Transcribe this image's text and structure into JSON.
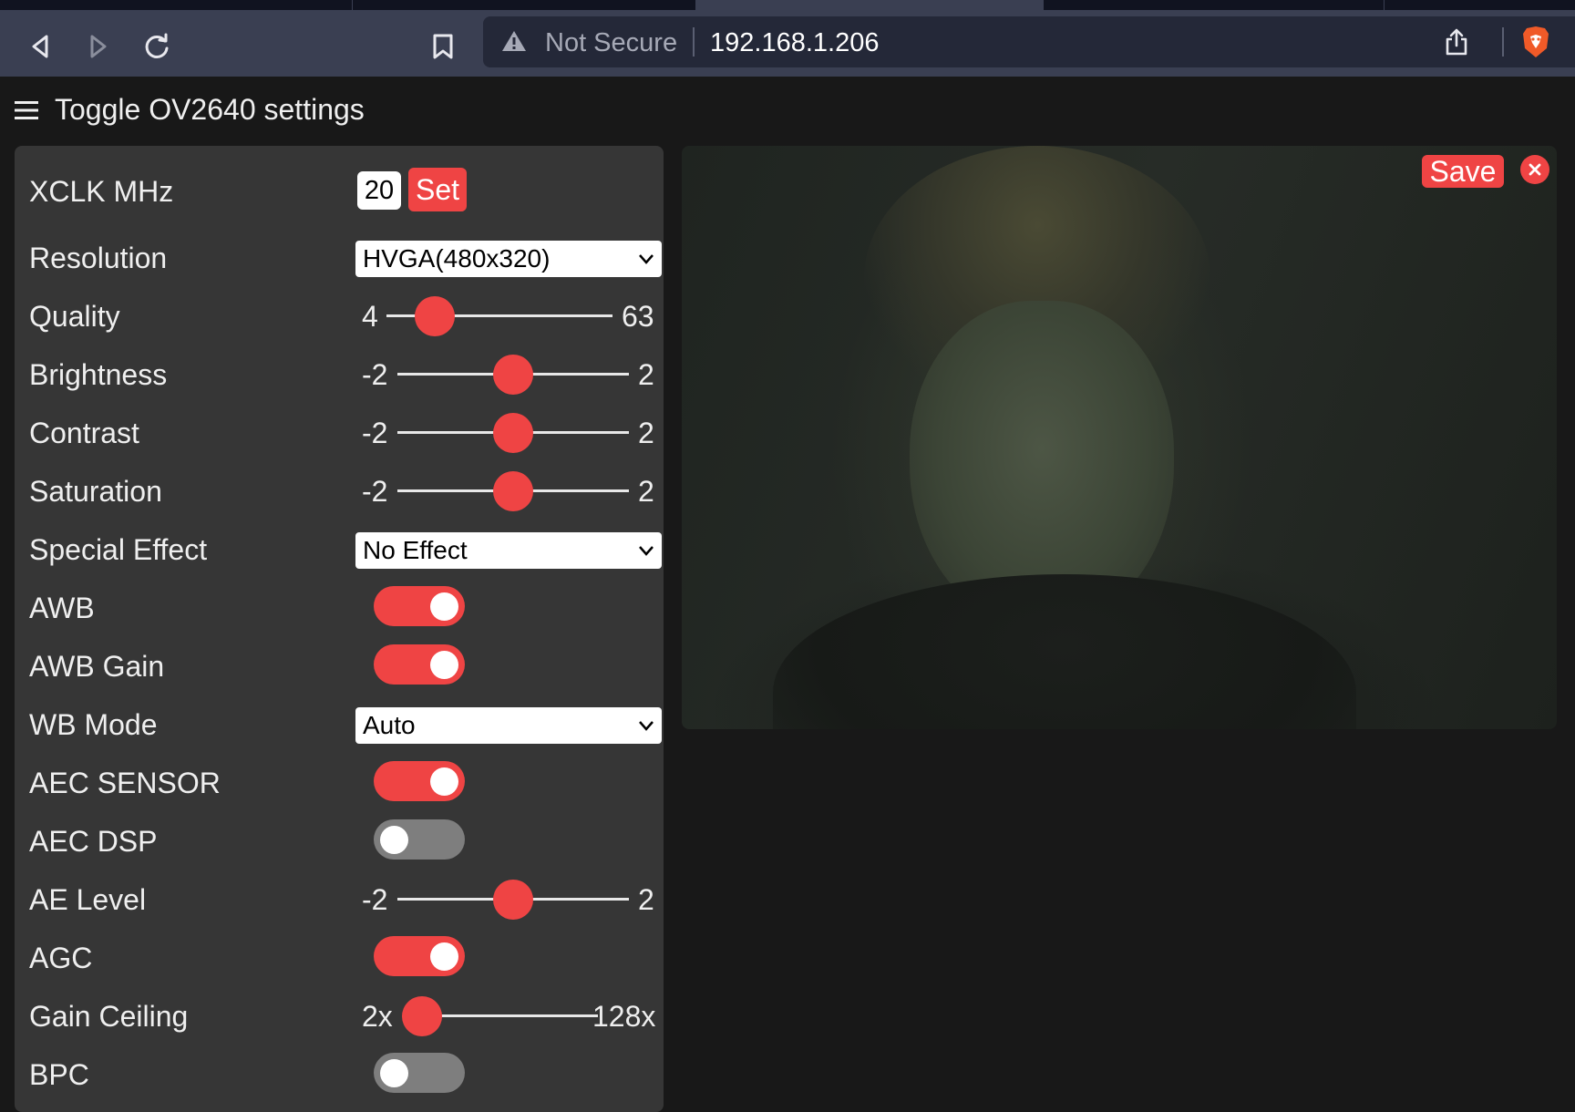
{
  "browser": {
    "security_label": "Not Secure",
    "url_host": "192.168.1.206"
  },
  "header": {
    "toggle_label": "Toggle OV2640 settings"
  },
  "settings": {
    "xclk": {
      "label": "XCLK MHz",
      "value": "20",
      "button": "Set"
    },
    "resolution": {
      "label": "Resolution",
      "selected": "HVGA(480x320)"
    },
    "quality": {
      "label": "Quality",
      "min": "4",
      "max": "63",
      "level": 0.1
    },
    "brightness": {
      "label": "Brightness",
      "min": "-2",
      "max": "2",
      "value": 0
    },
    "contrast": {
      "label": "Contrast",
      "min": "-2",
      "max": "2",
      "value": 0
    },
    "saturation": {
      "label": "Saturation",
      "min": "-2",
      "max": "2",
      "value": 0
    },
    "special_effect": {
      "label": "Special Effect",
      "selected": "No Effect"
    },
    "awb": {
      "label": "AWB",
      "on": true
    },
    "awb_gain": {
      "label": "AWB Gain",
      "on": true
    },
    "wb_mode": {
      "label": "WB Mode",
      "selected": "Auto"
    },
    "aec_sensor": {
      "label": "AEC SENSOR",
      "on": true
    },
    "aec_dsp": {
      "label": "AEC DSP",
      "on": false
    },
    "ae_level": {
      "label": "AE Level",
      "min": "-2",
      "max": "2",
      "value": 0
    },
    "agc": {
      "label": "AGC",
      "on": true
    },
    "gain_ceiling": {
      "label": "Gain Ceiling",
      "min": "2x",
      "max": "128x",
      "level": 0
    },
    "bpc": {
      "label": "BPC",
      "on": false
    }
  },
  "stream": {
    "save_label": "Save"
  },
  "colors": {
    "accent": "#ef4444",
    "panel": "#363636",
    "background": "#181818",
    "toolbar": "#3a3f52"
  }
}
